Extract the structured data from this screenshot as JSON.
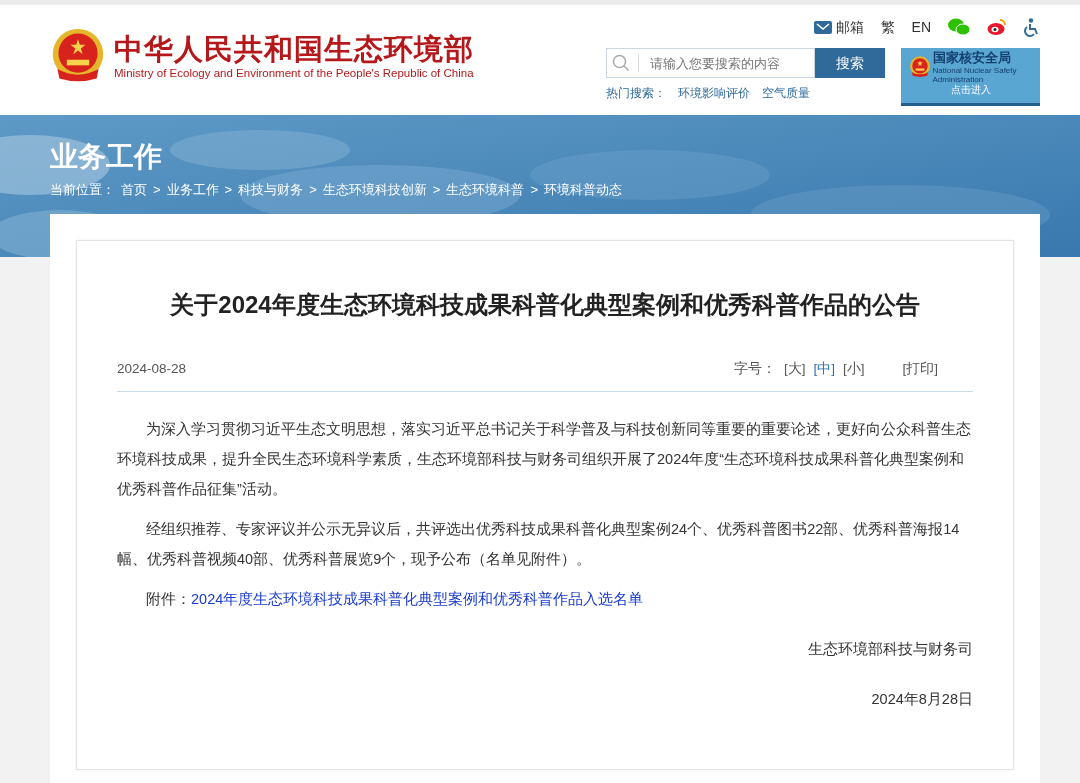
{
  "header": {
    "site_title": "中华人民共和国生态环境部",
    "site_subtitle": "Ministry of Ecology and Environment of the People's Republic of China",
    "top_links": [
      {
        "kind": "mail",
        "label": "邮箱"
      },
      {
        "kind": "text",
        "label": "繁"
      },
      {
        "kind": "text",
        "label": "EN"
      },
      {
        "kind": "wechat"
      },
      {
        "kind": "weibo"
      },
      {
        "kind": "accessibility"
      }
    ],
    "search": {
      "placeholder": "请输入您要搜索的内容",
      "button": "搜索"
    },
    "hot_search": {
      "label": "热门搜索：",
      "items": [
        "环境影响评价",
        "空气质量"
      ]
    },
    "promo": {
      "title": "国家核安全局",
      "subtitle": "National Nuclear Safety Administration",
      "action": "点击进入"
    }
  },
  "banner": {
    "title": "业务工作",
    "breadcrumb_label": "当前位置：",
    "breadcrumb": [
      "首页",
      "业务工作",
      "科技与财务",
      "生态环境科技创新",
      "生态环境科普",
      "环境科普动态"
    ],
    "separator": ">"
  },
  "article": {
    "title": "关于2024年度生态环境科技成果科普化典型案例和优秀科普作品的公告",
    "date": "2024-08-28",
    "font_size_label": "字号：",
    "font_sizes": [
      {
        "label": "[大]",
        "selected": false
      },
      {
        "label": "[中]",
        "selected": true
      },
      {
        "label": "[小]",
        "selected": false
      }
    ],
    "print": "[打印]",
    "paragraphs": [
      "为深入学习贯彻习近平生态文明思想，落实习近平总书记关于科学普及与科技创新同等重要的重要论述，更好向公众科普生态环境科技成果，提升全民生态环境科学素质，生态环境部科技与财务司组织开展了2024年度“生态环境科技成果科普化典型案例和优秀科普作品征集”活动。",
      "经组织推荐、专家评议并公示无异议后，共评选出优秀科技成果科普化典型案例24个、优秀科普图书22部、优秀科普海报14幅、优秀科普视频40部、优秀科普展览9个，现予公布（名单见附件）。"
    ],
    "attachment_label": "附件：",
    "attachment_link": "2024年度生态环境科技成果科普化典型案例和优秀科普作品入选名单",
    "signature": "生态环境部科技与财务司",
    "signed_date": "2024年8月28日"
  }
}
